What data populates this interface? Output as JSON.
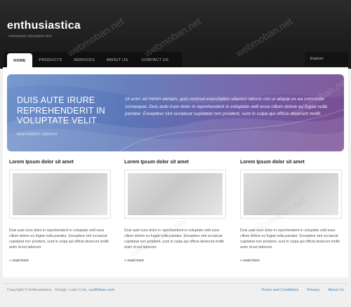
{
  "site": {
    "title": "enthusiastica",
    "tagline": "enthusiastic description text"
  },
  "nav": {
    "items": [
      "HOME",
      "PRODUCTS",
      "SERVICES",
      "ABOUT US",
      "CONTACT US"
    ],
    "explore": "Explore"
  },
  "banner": {
    "title": "DUIS AUTE IRURE REPREHENDERIT IN VOLUPTATE VELIT",
    "subtitle": "exercitation ullamco",
    "text": "Ut enim ad minim veniam, quis nostrud exercitation ullamco laboris nisi ut aliquip ex ea commodo consequat. Duis aute irure dolor in reprehenderit in voluptate velit esse cillum dolore eu fugiat nulla pariatur. Excepteur sint occaecat cupidatat non proident, sunt in culpa qui officia deserunt mollit."
  },
  "columns": [
    {
      "title": "Lorem Ipsum dolor sit amet",
      "text": "Duis aute irure dolor in reprehenderit in voluptate velit esse cillum dolore eu fugiat nulla pariatur. Excepteur sint occaecat cupidatat non proident, sunt in culpa qui officia deserunt mollit anim id est laborum.",
      "link": "read more"
    },
    {
      "title": "Lorem Ipsum dolor sit amet",
      "text": "Duis aute irure dolor in reprehenderit in voluptate velit esse cillum dolore eu fugiat nulla pariatur. Excepteur sint occaecat cupidatat non proident, sunt in culpa qui officia deserunt mollit anim id est laborum.",
      "link": "read more"
    },
    {
      "title": "Lorem Ipsum dolor sit amet",
      "text": "Duis aute irure dolor in reprehenderit in voluptate velit esse cillum dolore eu fugiat nulla pariatur. Excepteur sint occaecat cupidatat non proident, sunt in culpa qui officia deserunt mollit anim id est laborum.",
      "link": "read more"
    }
  ],
  "footer": {
    "copyright": "Copyright © Enthusiastica · Design: Luka Cvrk,",
    "credit_link": "cssMoban.com",
    "links": [
      "Terms and Conditions",
      "Privacy",
      "About Us"
    ]
  },
  "watermark": "webmoban.net"
}
